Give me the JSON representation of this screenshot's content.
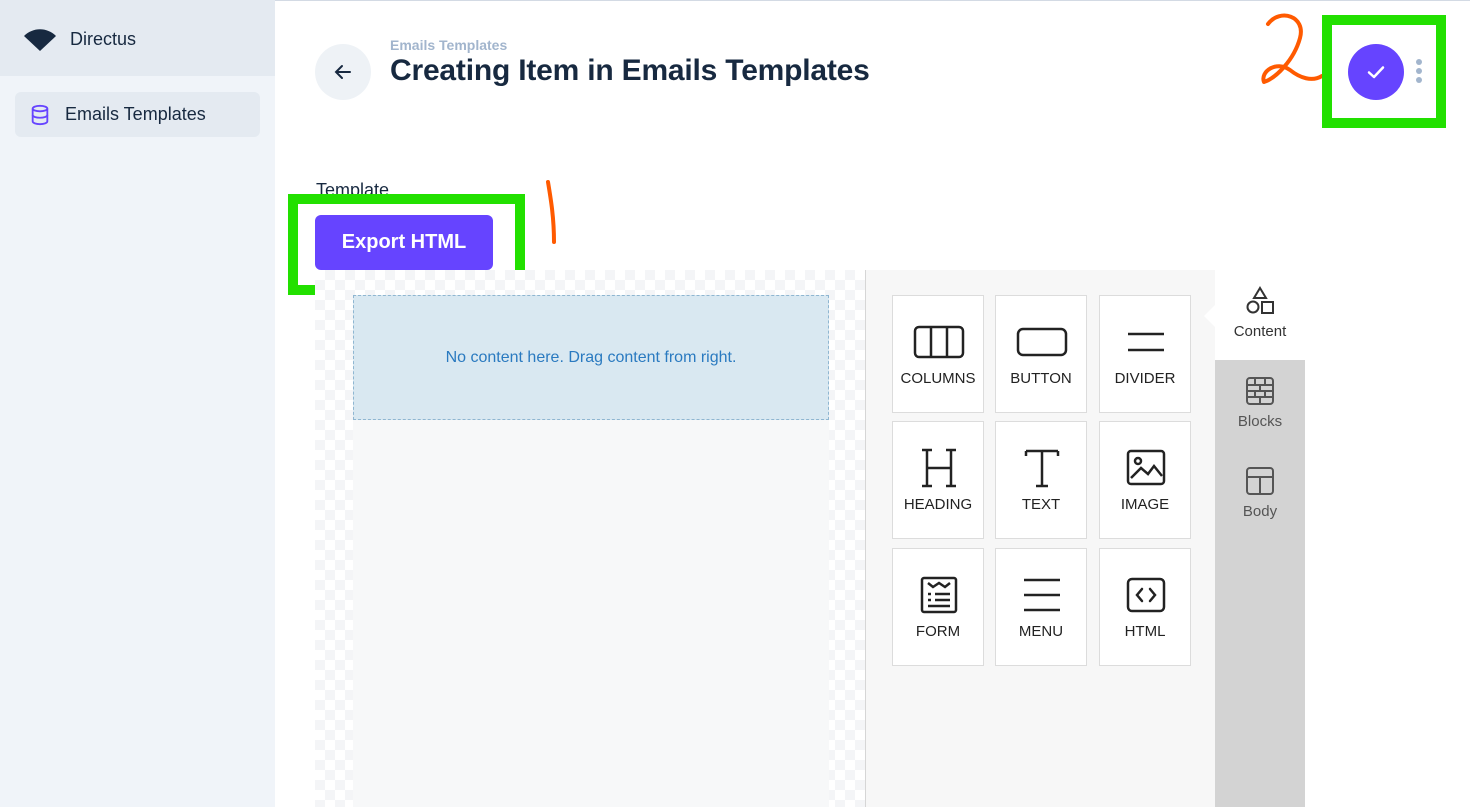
{
  "sidebar": {
    "brand_name": "Directus",
    "nav_items": [
      {
        "label": "Emails Templates",
        "icon": "database-icon",
        "active": true
      }
    ]
  },
  "header": {
    "breadcrumb": "Emails Templates",
    "title": "Creating Item in Emails Templates",
    "back_icon": "arrow-left-icon",
    "save_icon": "check-icon",
    "more_icon": "more-vertical-icon"
  },
  "form": {
    "field_label": "Template",
    "export_button_label": "Export HTML"
  },
  "editor": {
    "empty_message": "No content here. Drag content from right.",
    "tools": [
      {
        "label": "COLUMNS",
        "icon": "columns-icon"
      },
      {
        "label": "BUTTON",
        "icon": "button-icon"
      },
      {
        "label": "DIVIDER",
        "icon": "divider-icon"
      },
      {
        "label": "HEADING",
        "icon": "heading-icon"
      },
      {
        "label": "TEXT",
        "icon": "text-icon"
      },
      {
        "label": "IMAGE",
        "icon": "image-icon"
      },
      {
        "label": "FORM",
        "icon": "form-icon"
      },
      {
        "label": "MENU",
        "icon": "menu-icon"
      },
      {
        "label": "HTML",
        "icon": "html-icon"
      }
    ],
    "tabs": [
      {
        "label": "Content",
        "icon": "shapes-icon",
        "active": true
      },
      {
        "label": "Blocks",
        "icon": "blocks-icon"
      },
      {
        "label": "Body",
        "icon": "layout-icon"
      }
    ]
  },
  "annotations": {
    "step_1": "1",
    "step_2": "2",
    "highlight_color": "#22e000",
    "ink_color": "#ff5a00"
  },
  "colors": {
    "accent": "#6644ff",
    "sidebar_bg": "#f0f4f9",
    "dropzone_bg": "#d9e8f1"
  }
}
